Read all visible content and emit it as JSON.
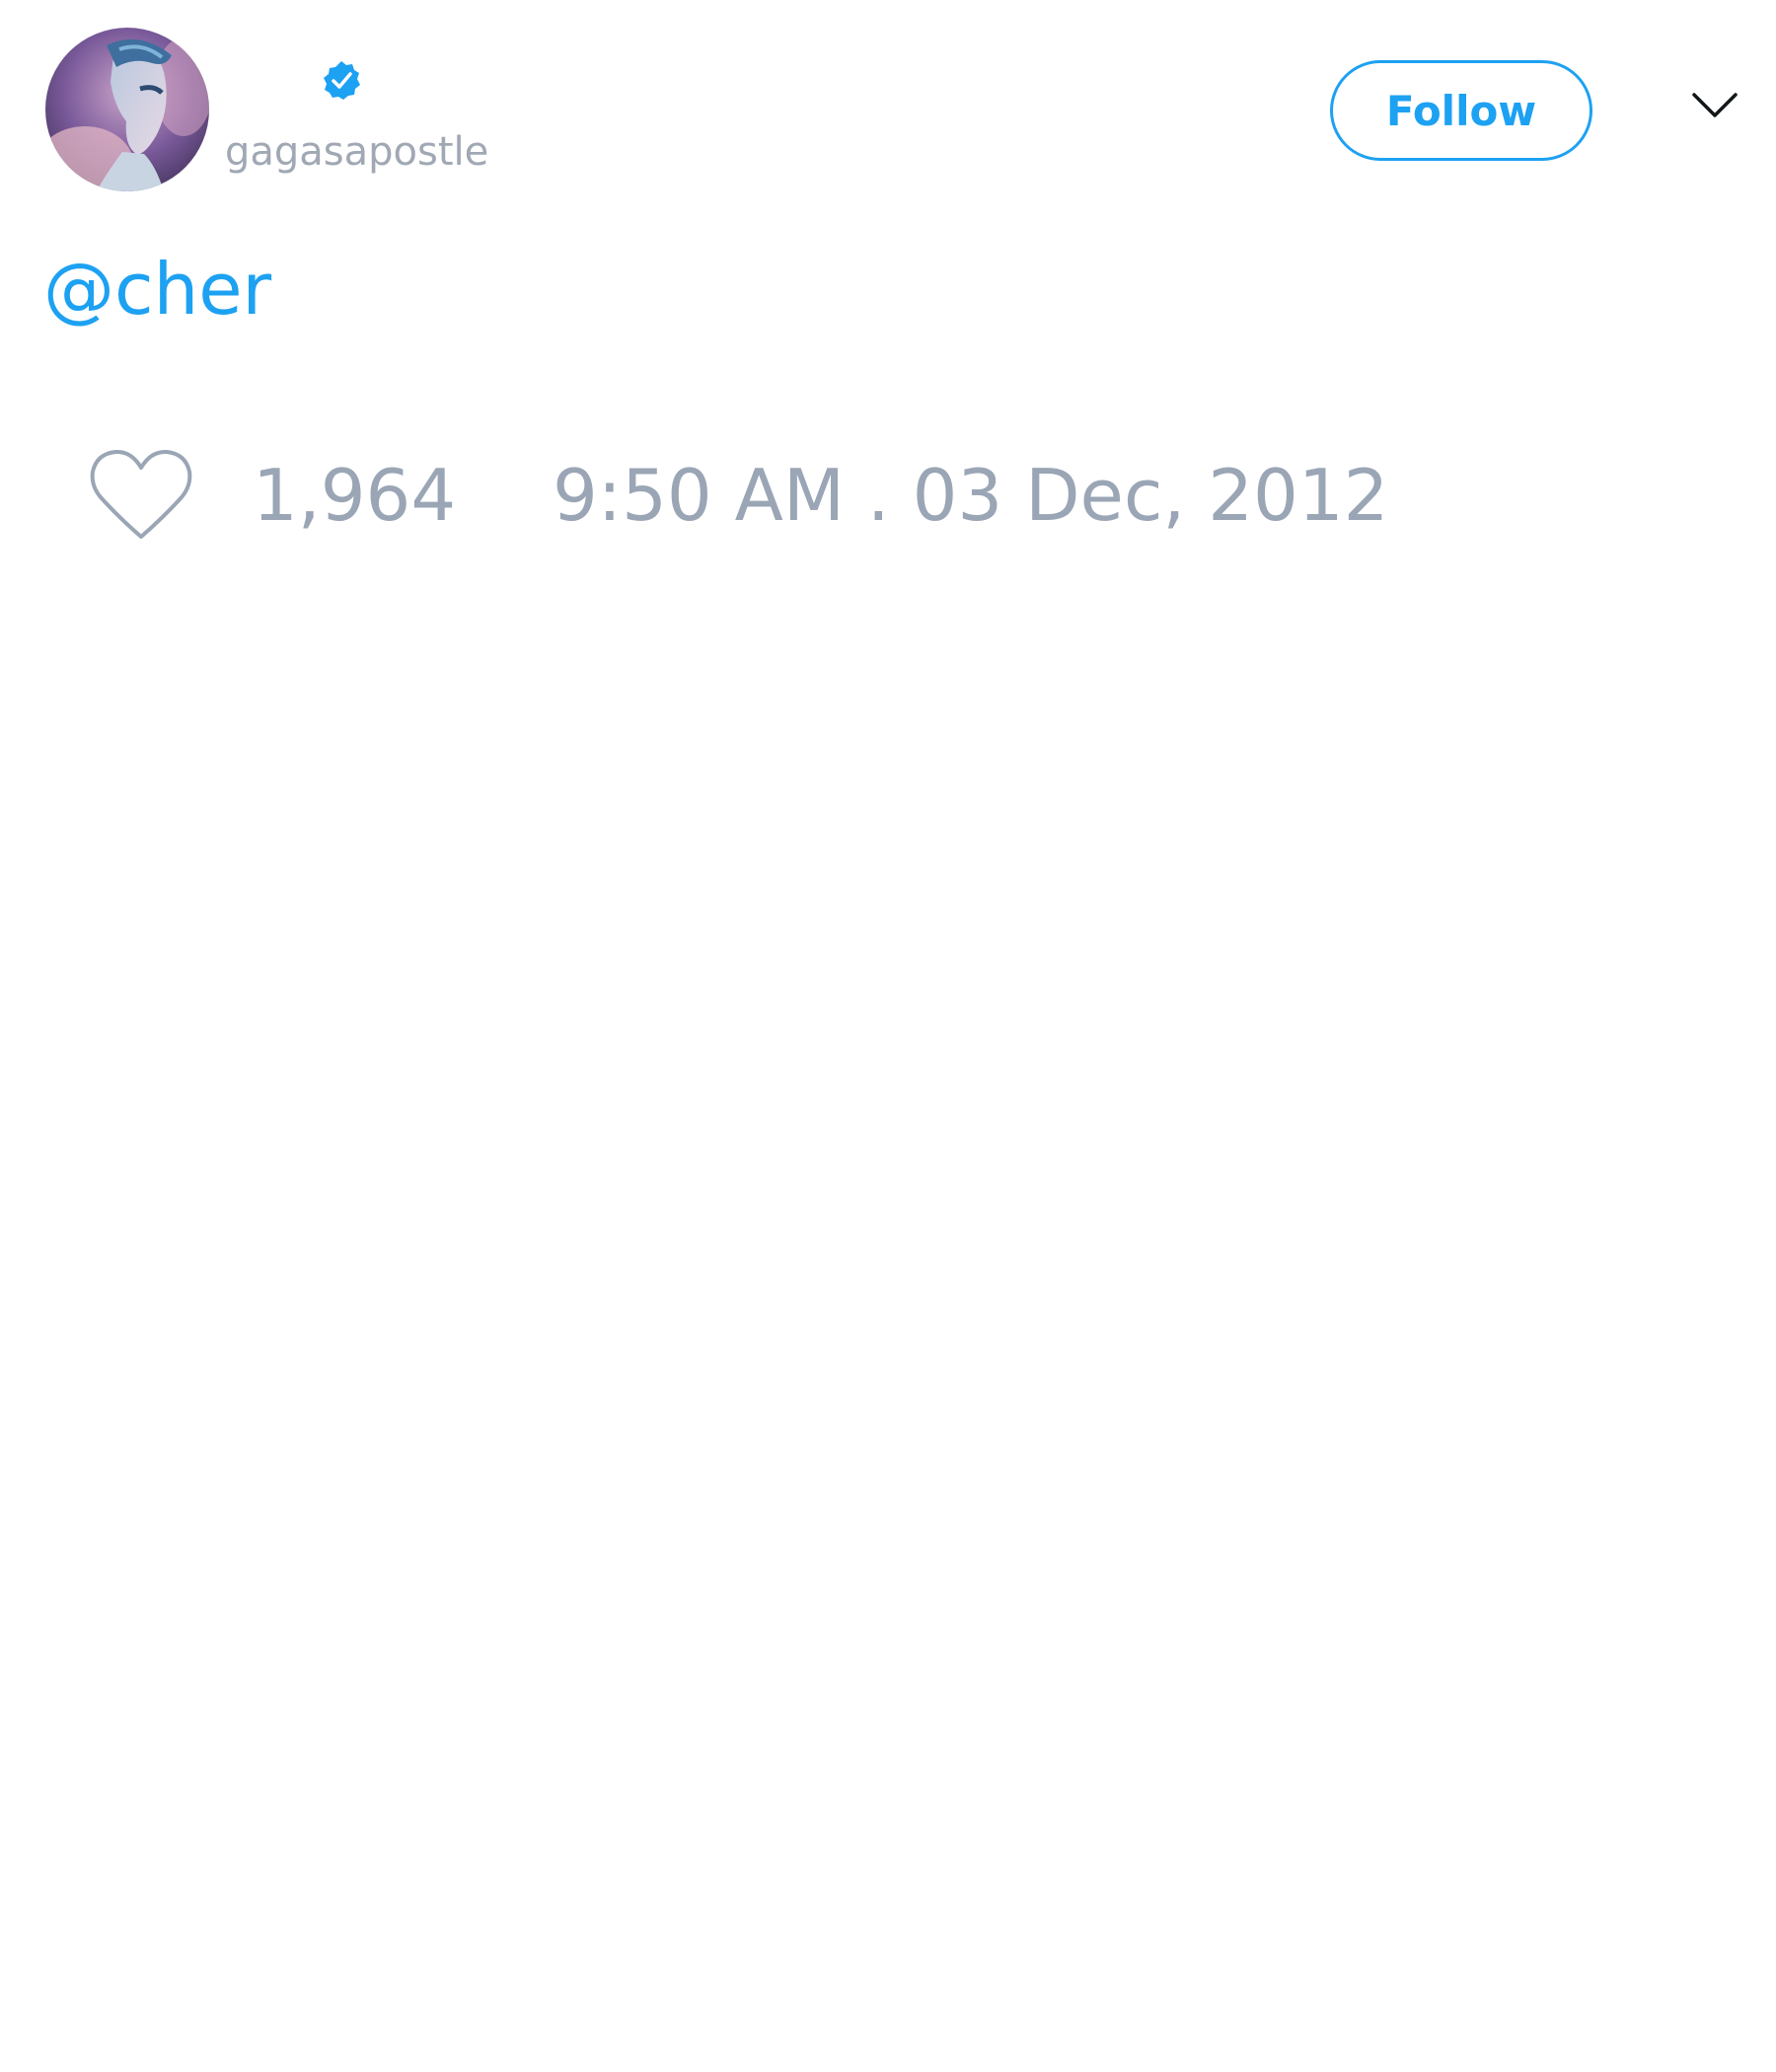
{
  "author": {
    "display_name": "",
    "handle": "gagasapostle",
    "verified": true,
    "avatar_icon": "profile-photo"
  },
  "actions": {
    "follow_label": "Follow",
    "menu_icon": "chevron-down-icon"
  },
  "tweet": {
    "text": "@cher"
  },
  "footer": {
    "like_icon": "heart-icon",
    "like_count": "1,964",
    "timestamp": "9:50 AM . 03 Dec, 2012"
  },
  "colors": {
    "accent": "#1da1f2",
    "muted_text": "#9aa5b5",
    "handle_text": "#a0a8b4",
    "background": "#ffffff"
  }
}
